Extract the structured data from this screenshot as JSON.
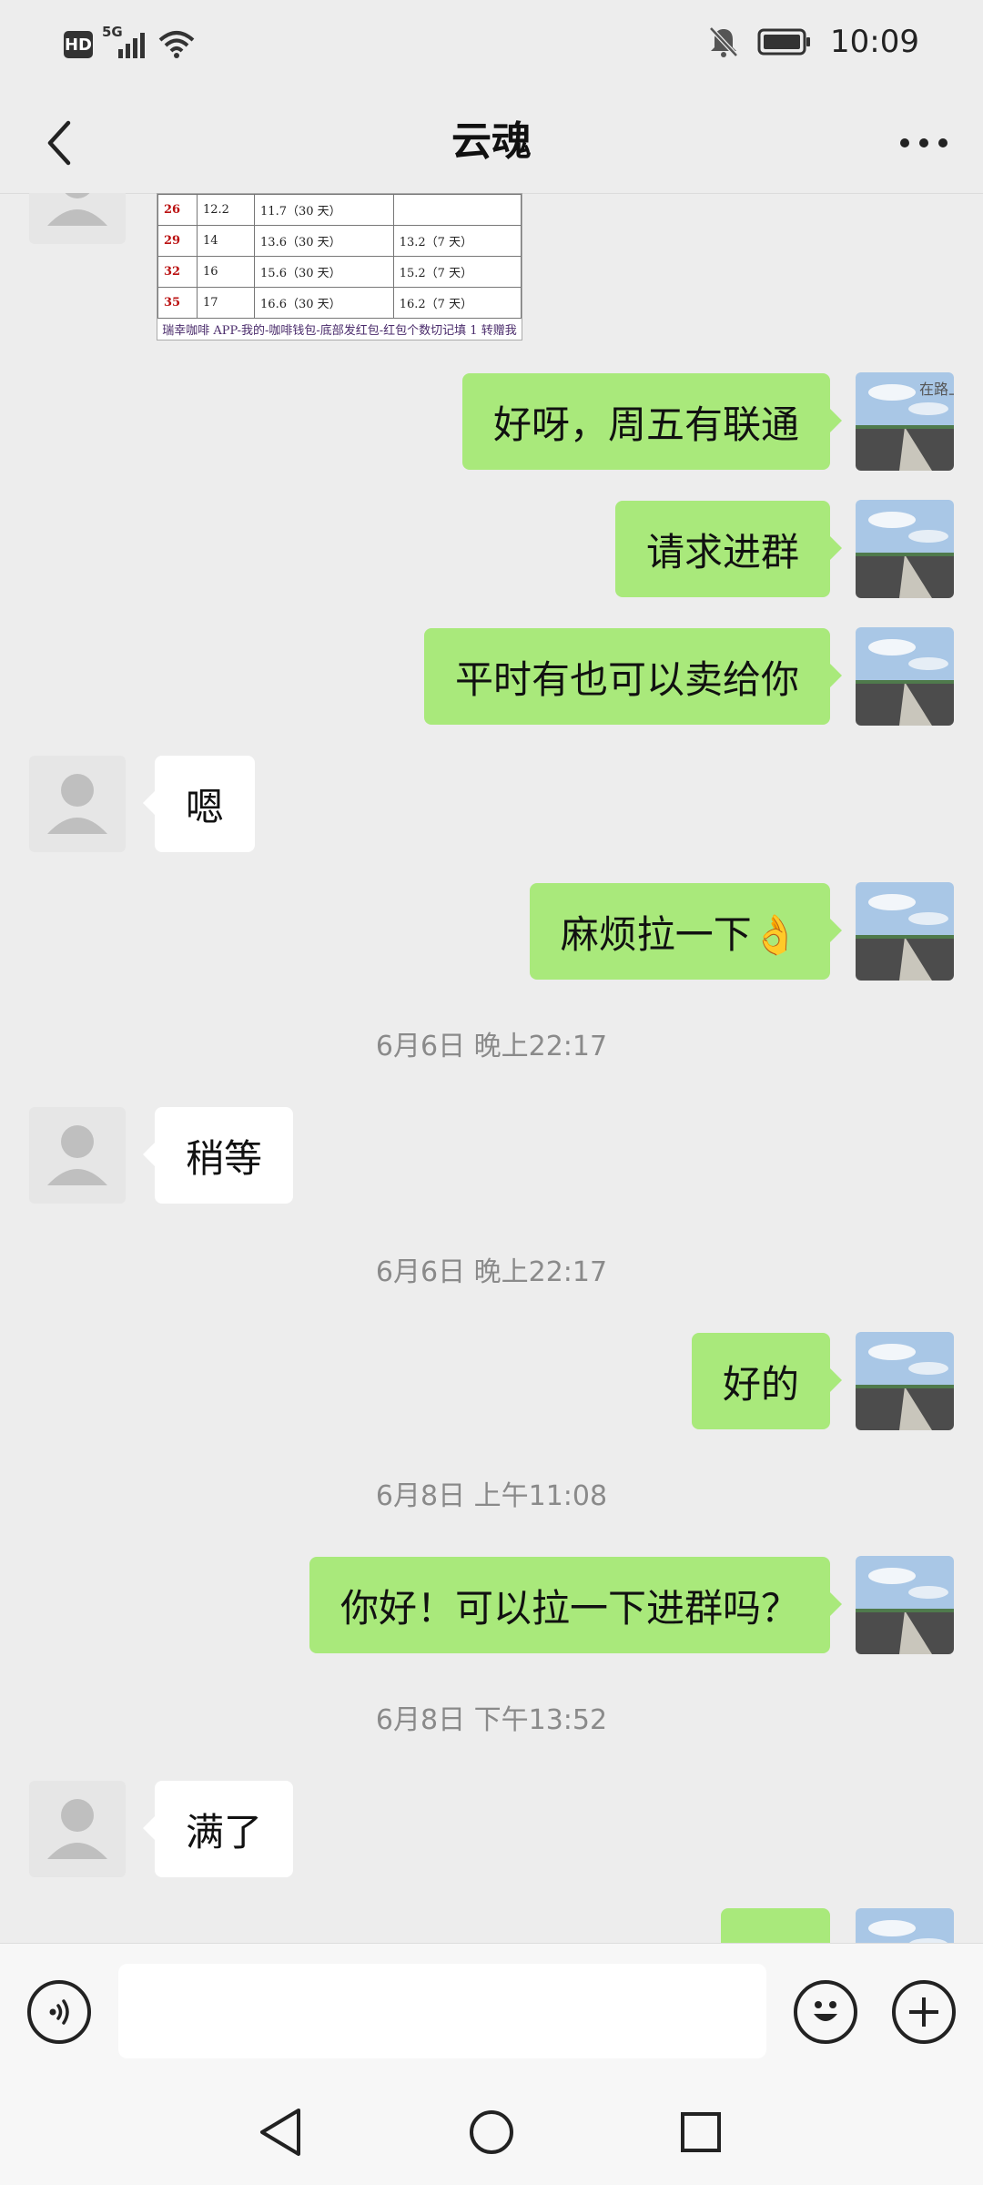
{
  "status_bar": {
    "hd": "HD",
    "network": "5G",
    "time": "10:09"
  },
  "header": {
    "title": "云魂"
  },
  "image_message": {
    "rows": [
      [
        "26",
        "12.2",
        "11.7（30 天）",
        ""
      ],
      [
        "29",
        "14",
        "13.6（30 天）",
        "13.2（7 天）"
      ],
      [
        "32",
        "16",
        "15.6（30 天）",
        "15.2（7 天）"
      ],
      [
        "35",
        "17",
        "16.6（30 天）",
        "16.2（7 天）"
      ]
    ],
    "footer": "瑞幸咖啡 APP-我的-咖啡钱包-底部发红包-红包个数切记填 1 转赠我"
  },
  "messages": [
    {
      "from": "self",
      "text": "好呀，周五有联通"
    },
    {
      "from": "self",
      "text": "请求进群"
    },
    {
      "from": "self",
      "text": "平时有也可以卖给你"
    },
    {
      "from": "other",
      "text": "嗯"
    },
    {
      "from": "self",
      "text": "麻烦拉一下👌"
    },
    {
      "timestamp": "6月6日 晚上22:17"
    },
    {
      "from": "other",
      "text": "稍等"
    },
    {
      "timestamp": "6月6日 晚上22:17"
    },
    {
      "from": "self",
      "text": "好的"
    },
    {
      "timestamp": "6月8日 上午11:08"
    },
    {
      "from": "self",
      "text": "你好！可以拉一下进群吗？"
    },
    {
      "timestamp": "6月8日 下午13:52"
    },
    {
      "from": "other",
      "text": "满了"
    },
    {
      "from": "self",
      "text": ""
    }
  ],
  "avatar_caption": "在路上",
  "input": {
    "value": ""
  },
  "colors": {
    "self_bubble": "#a9e97b",
    "other_bubble": "#ffffff",
    "background": "#ededed"
  }
}
